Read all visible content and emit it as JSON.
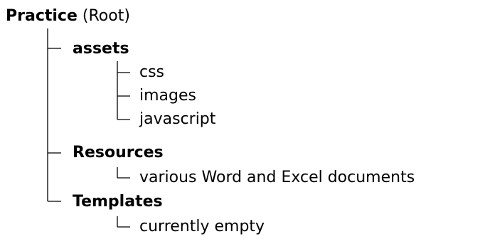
{
  "tree": {
    "root": {
      "name": "Practice",
      "note": "(Root)"
    },
    "folders": [
      {
        "name": "assets",
        "children": [
          "css",
          "images",
          "javascript"
        ]
      },
      {
        "name": "Resources",
        "children": [
          "various Word and Excel documents"
        ]
      },
      {
        "name": "Templates",
        "children": [
          "currently empty"
        ]
      }
    ]
  }
}
